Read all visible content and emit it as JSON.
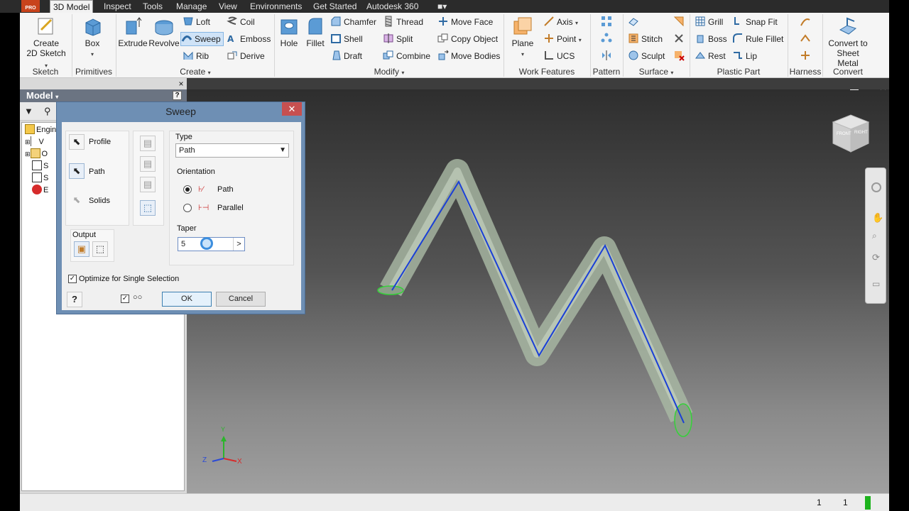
{
  "app": {
    "badge": "PRO"
  },
  "menu": {
    "tabs": [
      "3D Model",
      "Inspect",
      "Tools",
      "Manage",
      "View",
      "Environments",
      "Get Started",
      "Autodesk 360"
    ],
    "active_tab": "3D Model"
  },
  "ribbon": {
    "panels": {
      "sketch": "Sketch",
      "primitives": "Primitives",
      "create": "Create",
      "modify": "Modify",
      "work_features": "Work Features",
      "pattern": "Pattern",
      "surface": "Surface",
      "plastic_part": "Plastic Part",
      "harness": "Harness",
      "convert": "Convert"
    },
    "buttons": {
      "create_sketch_1": "Create",
      "create_sketch_2": "2D Sketch",
      "box": "Box",
      "extrude": "Extrude",
      "revolve": "Revolve",
      "loft": "Loft",
      "sweep": "Sweep",
      "rib": "Rib",
      "coil": "Coil",
      "emboss": "Emboss",
      "derive": "Derive",
      "hole": "Hole",
      "fillet": "Fillet",
      "chamfer": "Chamfer",
      "shell": "Shell",
      "draft": "Draft",
      "thread": "Thread",
      "split": "Split",
      "combine": "Combine",
      "move_face": "Move Face",
      "copy_object": "Copy Object",
      "move_bodies": "Move Bodies",
      "plane": "Plane",
      "axis": "Axis",
      "point": "Point",
      "ucs": "UCS",
      "stitch": "Stitch",
      "sculpt": "Sculpt",
      "grill": "Grill",
      "boss": "Boss",
      "rest": "Rest",
      "snap_fit": "Snap Fit",
      "rule_fillet": "Rule Fillet",
      "lip": "Lip",
      "convert_1": "Convert to",
      "convert_2": "Sheet Metal"
    }
  },
  "browser": {
    "title": "Model",
    "help": "?",
    "close": "×",
    "tree": [
      "Engin",
      "V",
      "O",
      "S",
      "S",
      "E"
    ]
  },
  "dialog": {
    "title": "Sweep",
    "close": "✕",
    "profile": "Profile",
    "path": "Path",
    "solids": "Solids",
    "output": "Output",
    "type_label": "Type",
    "type_value": "Path",
    "orientation_label": "Orientation",
    "orientation_path": "Path",
    "orientation_parallel": "Parallel",
    "taper_label": "Taper",
    "taper_value": "5",
    "taper_arrow": ">",
    "optimize": "Optimize for Single Selection",
    "ok": "OK",
    "cancel": "Cancel",
    "help": "?"
  },
  "viewcube": {
    "front": "FRONT",
    "right": "RIGHT"
  },
  "triad": {
    "x": "X",
    "y": "Y",
    "z": "Z"
  },
  "status": {
    "left_num": "1",
    "right_num": "1"
  },
  "colors": {
    "path_line": "#1a3fd6",
    "tube": "#8fa889",
    "tube_edge": "#36d13a",
    "accent": "#3d8ede"
  }
}
